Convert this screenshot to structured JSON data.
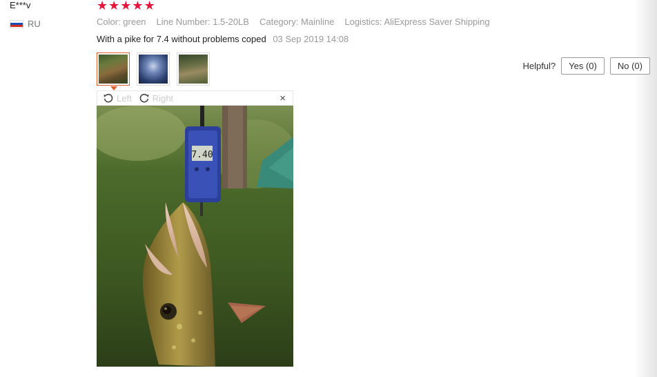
{
  "reviewer": {
    "name": "E***v",
    "country_code": "RU"
  },
  "rating": {
    "stars": 5,
    "max": 5
  },
  "meta": {
    "color": "Color: green",
    "line_number": "Line Number: 1.5-20LB",
    "category": "Category: Mainline",
    "logistics": "Logistics: AliExpress Saver Shipping"
  },
  "feedback": {
    "text": "With a pike for 7.4 without problems coped",
    "date": "03 Sep 2019 14:08"
  },
  "helpful": {
    "label": "Helpful?",
    "yes": "Yes (0)",
    "no": "No (0)"
  },
  "viewer": {
    "left_label": "Left",
    "right_label": "Right",
    "close_glyph": "×"
  },
  "colors": {
    "star": "#e6153c",
    "accent": "#e0622a",
    "muted": "#999999"
  },
  "icons": [
    "rotate-left-icon",
    "rotate-right-icon",
    "close-icon",
    "star-icon",
    "flag-icon"
  ]
}
